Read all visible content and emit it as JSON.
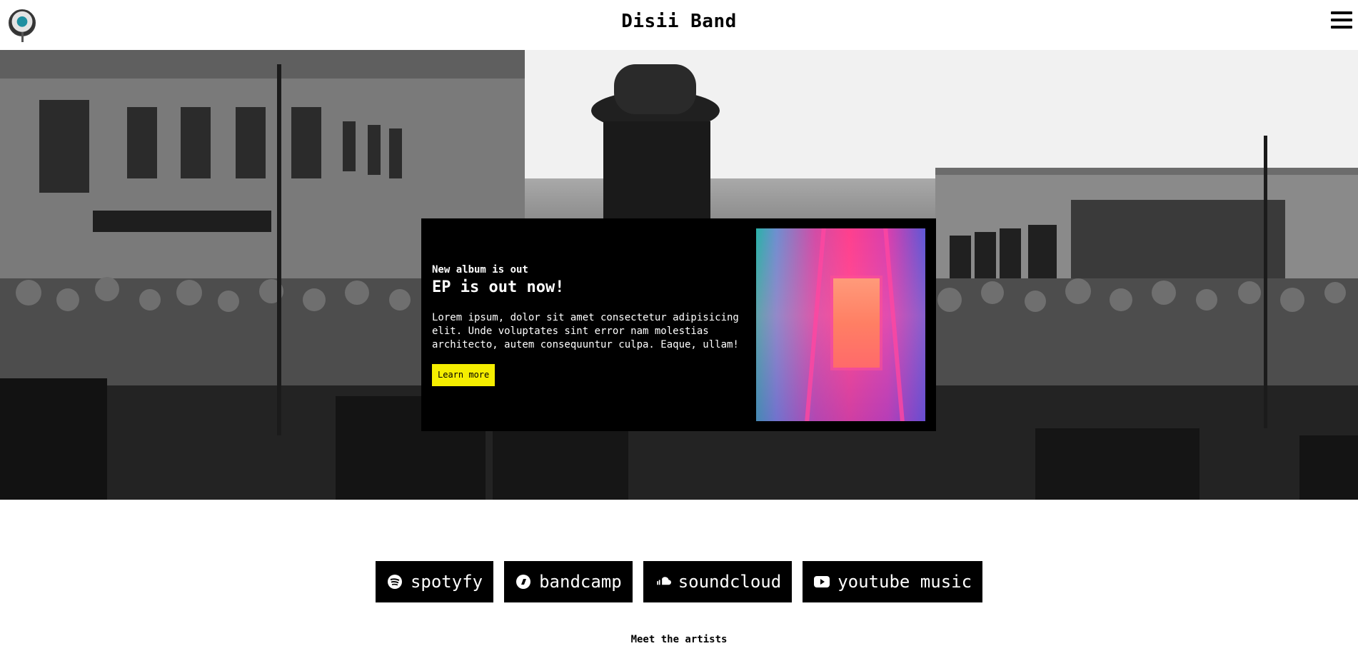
{
  "header": {
    "title": "Disii Band",
    "logo_icon": "band-logo-icon",
    "menu_icon": "hamburger-menu-icon"
  },
  "hero": {
    "description_icon": "concert-crowd-photo"
  },
  "promo": {
    "eyebrow": "New album is out",
    "headline": "EP is out now!",
    "body": "Lorem ipsum, dolor sit amet consectetur adipisicing elit. Unde voluptates sint error nam molestias architecto, autem consequuntur culpa. Eaque, ullam!",
    "cta_label": "Learn more",
    "cta_color": "#f5ee00",
    "cover_icon": "album-cover-image"
  },
  "platforms": [
    {
      "label": "spotyfy",
      "icon": "spotify-icon"
    },
    {
      "label": "bandcamp",
      "icon": "bandcamp-icon"
    },
    {
      "label": "soundcloud",
      "icon": "soundcloud-icon"
    },
    {
      "label": "youtube music",
      "icon": "youtube-icon"
    }
  ],
  "section": {
    "meet_title": "Meet the artists"
  }
}
